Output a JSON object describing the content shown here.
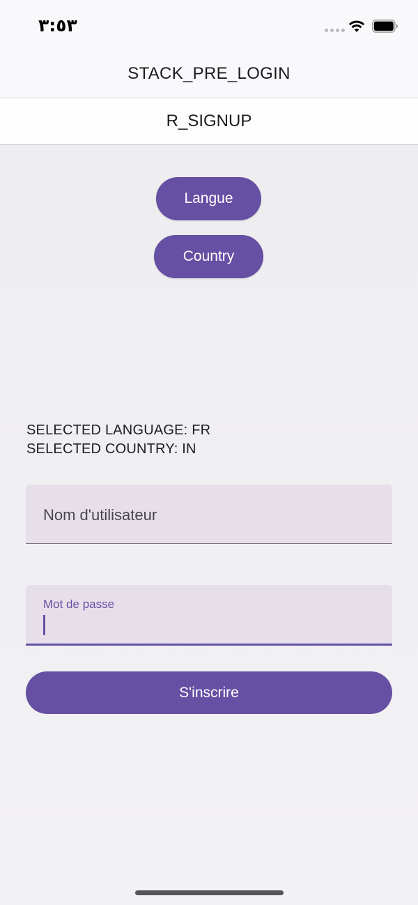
{
  "status_bar": {
    "time": "٣:٥٣",
    "icons": [
      "cellular-dots-icon",
      "wifi-icon",
      "battery-icon"
    ]
  },
  "header": {
    "title": "STACK_PRE_LOGIN",
    "subtitle": "R_SIGNUP"
  },
  "buttons": {
    "language_label": "Langue",
    "country_label": "Country",
    "submit_label": "S'inscrire"
  },
  "info": {
    "selected_language": "SELECTED LANGUAGE: FR",
    "selected_country": "SELECTED COUNTRY: IN"
  },
  "form": {
    "username": {
      "placeholder": "Nom d'utilisateur",
      "value": ""
    },
    "password": {
      "label": "Mot de passe",
      "value": ""
    }
  },
  "colors": {
    "accent": "#6650a4",
    "field_background": "#e6dfea",
    "page_background": "#f1f0f2"
  }
}
